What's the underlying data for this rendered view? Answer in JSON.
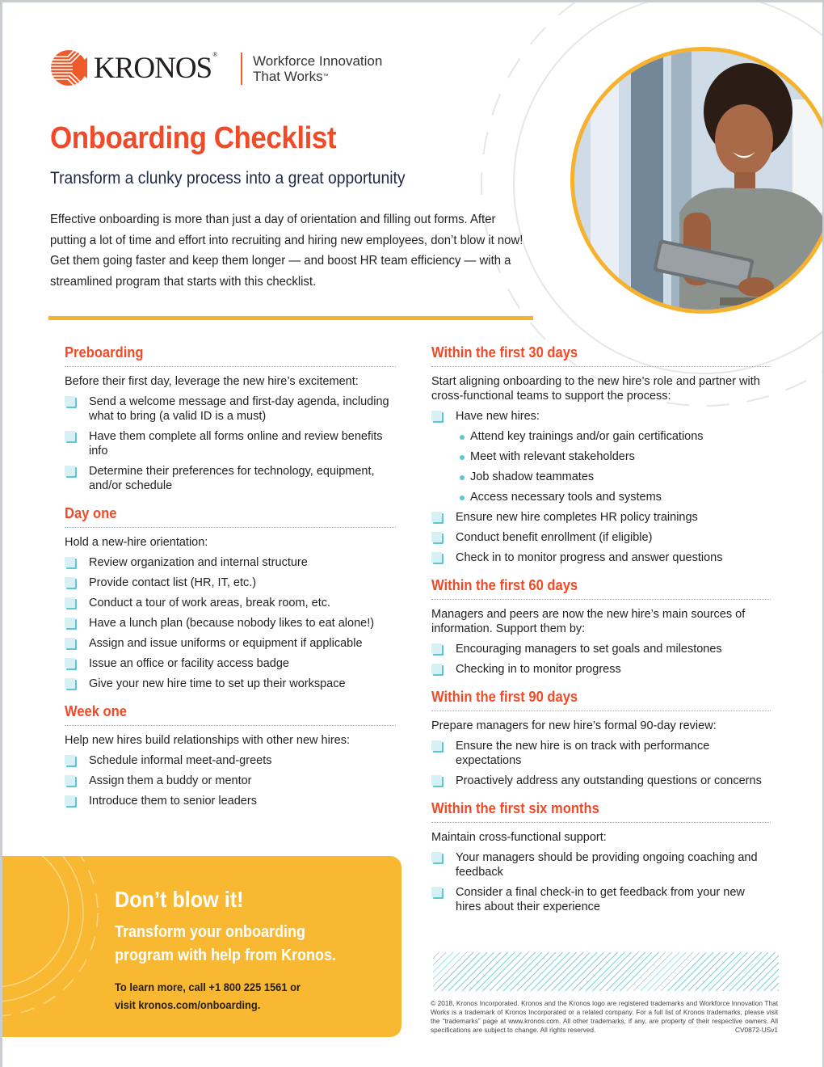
{
  "brand": {
    "logo_text": "KRONOS",
    "registered_mark": "®",
    "tagline_line1": "Workforce Innovation",
    "tagline_line2": "That Works",
    "trademark_mark": "™",
    "colors": {
      "orange": "#ef4b28",
      "yellow": "#f7b22d",
      "teal": "#5fc6d3"
    }
  },
  "header": {
    "title": "Onboarding Checklist",
    "subtitle": "Transform a clunky process into a great opportunity",
    "intro": "Effective onboarding is more than just a day of orientation and filling out forms. After putting a lot of time and effort into recruiting and hiring new employees, don’t blow it now! Get them going faster and keep them longer — and boost HR team efficiency — with a streamlined program that starts with this checklist."
  },
  "photo": {
    "description": "smiling woman holding a tablet"
  },
  "sections_left": [
    {
      "title": "Preboarding",
      "lead": "Before their first day, leverage the new hire’s excitement:",
      "items": [
        "Send a welcome message and first-day agenda, including what to bring (a valid ID is a must)",
        "Have them complete all forms online and review benefits info",
        "Determine their preferences for technology, equipment, and/or schedule"
      ]
    },
    {
      "title": "Day one",
      "lead": "Hold a new-hire orientation:",
      "items": [
        "Review organization and internal structure",
        "Provide contact list (HR, IT, etc.)",
        "Conduct a tour of work areas, break room, etc.",
        "Have a lunch plan (because nobody likes to eat alone!)",
        "Assign and issue uniforms or equipment if applicable",
        "Issue an office or facility access badge",
        "Give your new hire time to set up their workspace"
      ]
    },
    {
      "title": "Week one",
      "lead": "Help new hires build relationships with other new hires:",
      "items": [
        "Schedule informal meet-and-greets",
        "Assign them a buddy or mentor",
        "Introduce them to senior leaders"
      ]
    }
  ],
  "sections_right": [
    {
      "title": "Within the first 30 days",
      "lead": "Start aligning onboarding to the new hire’s role and partner with cross-functional teams to support the process:",
      "items": [
        "Have new hires:",
        "Ensure new hire completes HR policy trainings",
        "Conduct benefit enrollment (if eligible)",
        "Check in to monitor progress and answer questions"
      ],
      "subitems": [
        "Attend key trainings and/or gain certifications",
        "Meet with relevant stakeholders",
        "Job shadow teammates",
        "Access necessary tools and systems"
      ]
    },
    {
      "title": "Within the first 60 days",
      "lead": "Managers and peers are now the new hire’s main sources of information. Support them by:",
      "items": [
        "Encouraging managers to set goals and milestones",
        "Checking in to monitor progress"
      ]
    },
    {
      "title": "Within the first 90 days",
      "lead": "Prepare managers for new hire’s formal 90-day review:",
      "items": [
        "Ensure the new hire is on track with performance expectations",
        "Proactively address any outstanding questions or concerns"
      ]
    },
    {
      "title": "Within the first six months",
      "lead": "Maintain cross-functional support:",
      "items": [
        "Your managers should be providing ongoing coaching and feedback",
        "Consider a final check-in to get feedback from your new hires about their experience"
      ]
    }
  ],
  "cta": {
    "title": "Don’t blow it!",
    "sub_line1": "Transform your onboarding",
    "sub_line2": "program with help from Kronos.",
    "contact_line1": "To learn more, call +1 800 225 1561 or",
    "contact_line2": "visit kronos.com/onboarding."
  },
  "legal": {
    "text": "© 2018, Kronos Incorporated. Kronos and the Kronos logo are registered trademarks and Workforce Innovation That Works is a trademark of Kronos Incorporated or a related company. For a full list of Kronos trademarks, please visit the “trademarks” page at www.kronos.com. All other trademarks, if any, are property of their respective owners. All specifications are subject to change. All rights reserved.",
    "code": "CV0872-USv1"
  }
}
